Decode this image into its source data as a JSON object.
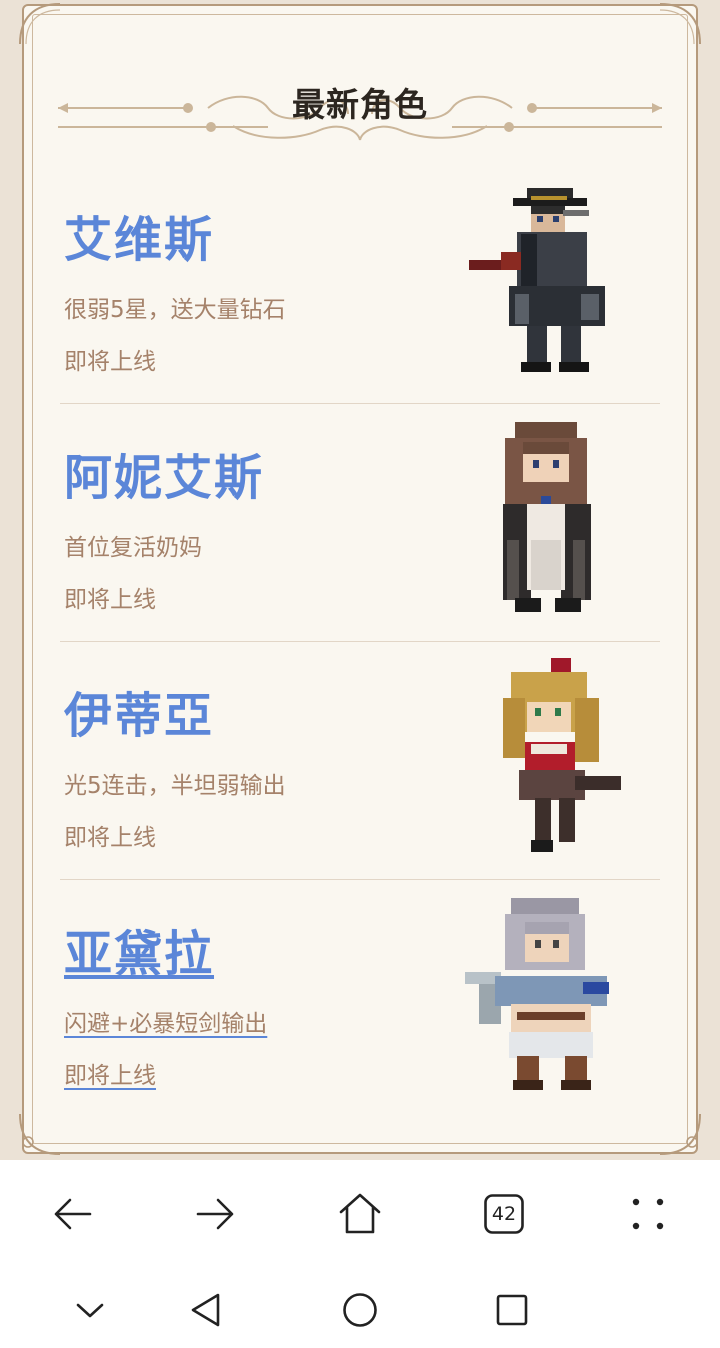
{
  "page": {
    "title": "最新角色"
  },
  "characters": [
    {
      "name": "艾维斯",
      "description": "很弱5星，送大量钻石",
      "status": "即将上线",
      "visited": false,
      "sprite": "sprite-gunslinger-hat"
    },
    {
      "name": "阿妮艾斯",
      "description": "首位复活奶妈",
      "status": "即将上线",
      "visited": false,
      "sprite": "sprite-long-hair-cloak"
    },
    {
      "name": "伊蒂亞",
      "description": "光5连击，半坦弱输出",
      "status": "即将上线",
      "visited": false,
      "sprite": "sprite-blonde-bow"
    },
    {
      "name": "亚黛拉",
      "description": "闪避+必暴短剑输出",
      "status": "即将上线",
      "visited": true,
      "sprite": "sprite-silver-hair-dagger"
    }
  ],
  "browser_toolbar": {
    "back_icon": "arrow-left-icon",
    "forward_icon": "arrow-right-icon",
    "home_icon": "home-icon",
    "tab_count": "42",
    "menu_icon": "dots-grid-icon"
  },
  "system_nav": {
    "collapse_icon": "chevron-down-icon",
    "back_icon": "triangle-back-icon",
    "home_icon": "circle-home-icon",
    "recents_icon": "square-recents-icon"
  },
  "colors": {
    "name_blue": "#5b86d8",
    "text_tan": "#a5826a",
    "parchment": "#faf7f0",
    "frame_border": "#b59a7c"
  }
}
